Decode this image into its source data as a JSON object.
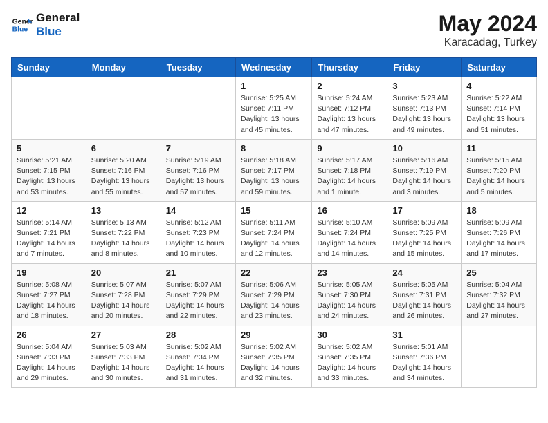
{
  "header": {
    "logo_general": "General",
    "logo_blue": "Blue",
    "month": "May 2024",
    "location": "Karacadag, Turkey"
  },
  "days_of_week": [
    "Sunday",
    "Monday",
    "Tuesday",
    "Wednesday",
    "Thursday",
    "Friday",
    "Saturday"
  ],
  "weeks": [
    [
      {
        "day": "",
        "info": ""
      },
      {
        "day": "",
        "info": ""
      },
      {
        "day": "",
        "info": ""
      },
      {
        "day": "1",
        "info": "Sunrise: 5:25 AM\nSunset: 7:11 PM\nDaylight: 13 hours\nand 45 minutes."
      },
      {
        "day": "2",
        "info": "Sunrise: 5:24 AM\nSunset: 7:12 PM\nDaylight: 13 hours\nand 47 minutes."
      },
      {
        "day": "3",
        "info": "Sunrise: 5:23 AM\nSunset: 7:13 PM\nDaylight: 13 hours\nand 49 minutes."
      },
      {
        "day": "4",
        "info": "Sunrise: 5:22 AM\nSunset: 7:14 PM\nDaylight: 13 hours\nand 51 minutes."
      }
    ],
    [
      {
        "day": "5",
        "info": "Sunrise: 5:21 AM\nSunset: 7:15 PM\nDaylight: 13 hours\nand 53 minutes."
      },
      {
        "day": "6",
        "info": "Sunrise: 5:20 AM\nSunset: 7:16 PM\nDaylight: 13 hours\nand 55 minutes."
      },
      {
        "day": "7",
        "info": "Sunrise: 5:19 AM\nSunset: 7:16 PM\nDaylight: 13 hours\nand 57 minutes."
      },
      {
        "day": "8",
        "info": "Sunrise: 5:18 AM\nSunset: 7:17 PM\nDaylight: 13 hours\nand 59 minutes."
      },
      {
        "day": "9",
        "info": "Sunrise: 5:17 AM\nSunset: 7:18 PM\nDaylight: 14 hours\nand 1 minute."
      },
      {
        "day": "10",
        "info": "Sunrise: 5:16 AM\nSunset: 7:19 PM\nDaylight: 14 hours\nand 3 minutes."
      },
      {
        "day": "11",
        "info": "Sunrise: 5:15 AM\nSunset: 7:20 PM\nDaylight: 14 hours\nand 5 minutes."
      }
    ],
    [
      {
        "day": "12",
        "info": "Sunrise: 5:14 AM\nSunset: 7:21 PM\nDaylight: 14 hours\nand 7 minutes."
      },
      {
        "day": "13",
        "info": "Sunrise: 5:13 AM\nSunset: 7:22 PM\nDaylight: 14 hours\nand 8 minutes."
      },
      {
        "day": "14",
        "info": "Sunrise: 5:12 AM\nSunset: 7:23 PM\nDaylight: 14 hours\nand 10 minutes."
      },
      {
        "day": "15",
        "info": "Sunrise: 5:11 AM\nSunset: 7:24 PM\nDaylight: 14 hours\nand 12 minutes."
      },
      {
        "day": "16",
        "info": "Sunrise: 5:10 AM\nSunset: 7:24 PM\nDaylight: 14 hours\nand 14 minutes."
      },
      {
        "day": "17",
        "info": "Sunrise: 5:09 AM\nSunset: 7:25 PM\nDaylight: 14 hours\nand 15 minutes."
      },
      {
        "day": "18",
        "info": "Sunrise: 5:09 AM\nSunset: 7:26 PM\nDaylight: 14 hours\nand 17 minutes."
      }
    ],
    [
      {
        "day": "19",
        "info": "Sunrise: 5:08 AM\nSunset: 7:27 PM\nDaylight: 14 hours\nand 18 minutes."
      },
      {
        "day": "20",
        "info": "Sunrise: 5:07 AM\nSunset: 7:28 PM\nDaylight: 14 hours\nand 20 minutes."
      },
      {
        "day": "21",
        "info": "Sunrise: 5:07 AM\nSunset: 7:29 PM\nDaylight: 14 hours\nand 22 minutes."
      },
      {
        "day": "22",
        "info": "Sunrise: 5:06 AM\nSunset: 7:29 PM\nDaylight: 14 hours\nand 23 minutes."
      },
      {
        "day": "23",
        "info": "Sunrise: 5:05 AM\nSunset: 7:30 PM\nDaylight: 14 hours\nand 24 minutes."
      },
      {
        "day": "24",
        "info": "Sunrise: 5:05 AM\nSunset: 7:31 PM\nDaylight: 14 hours\nand 26 minutes."
      },
      {
        "day": "25",
        "info": "Sunrise: 5:04 AM\nSunset: 7:32 PM\nDaylight: 14 hours\nand 27 minutes."
      }
    ],
    [
      {
        "day": "26",
        "info": "Sunrise: 5:04 AM\nSunset: 7:33 PM\nDaylight: 14 hours\nand 29 minutes."
      },
      {
        "day": "27",
        "info": "Sunrise: 5:03 AM\nSunset: 7:33 PM\nDaylight: 14 hours\nand 30 minutes."
      },
      {
        "day": "28",
        "info": "Sunrise: 5:02 AM\nSunset: 7:34 PM\nDaylight: 14 hours\nand 31 minutes."
      },
      {
        "day": "29",
        "info": "Sunrise: 5:02 AM\nSunset: 7:35 PM\nDaylight: 14 hours\nand 32 minutes."
      },
      {
        "day": "30",
        "info": "Sunrise: 5:02 AM\nSunset: 7:35 PM\nDaylight: 14 hours\nand 33 minutes."
      },
      {
        "day": "31",
        "info": "Sunrise: 5:01 AM\nSunset: 7:36 PM\nDaylight: 14 hours\nand 34 minutes."
      },
      {
        "day": "",
        "info": ""
      }
    ]
  ]
}
